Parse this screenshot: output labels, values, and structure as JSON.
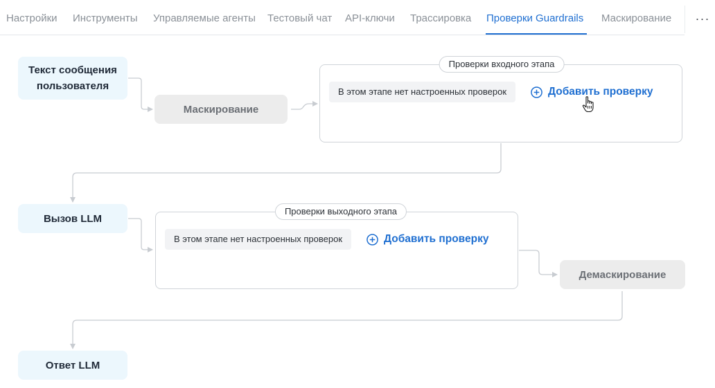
{
  "tabs": [
    {
      "label": "Настройки",
      "active": false
    },
    {
      "label": "Инструменты",
      "active": false
    },
    {
      "label": "Управляемые агенты",
      "active": false
    },
    {
      "label": "Тестовый чат",
      "active": false
    },
    {
      "label": "API-ключи",
      "active": false
    },
    {
      "label": "Трассировка",
      "active": false
    },
    {
      "label": "Проверки Guardrails",
      "active": true
    },
    {
      "label": "Маскирование",
      "active": false
    }
  ],
  "more_label": "···",
  "flow": {
    "user_message": "Текст сообщения пользователя",
    "masking": "Маскирование",
    "input_stage": {
      "title": "Проверки входного этапа",
      "empty_text": "В этом этапе нет настроенных проверок",
      "add_label": "Добавить проверку"
    },
    "llm_call": "Вызов LLM",
    "output_stage": {
      "title": "Проверки выходного этапа",
      "empty_text": "В этом этапе нет настроенных проверок",
      "add_label": "Добавить проверку"
    },
    "unmasking": "Демаскирование",
    "llm_response": "Ответ LLM"
  },
  "colors": {
    "accent": "#1f6fd1",
    "node_blue_bg": "#ecf7fd",
    "node_gray_bg": "#ececec",
    "connector": "#c8ccd1"
  },
  "icons": {
    "add": "plus-circle-icon",
    "cursor": "hand-pointer-icon",
    "more": "ellipsis-icon"
  }
}
